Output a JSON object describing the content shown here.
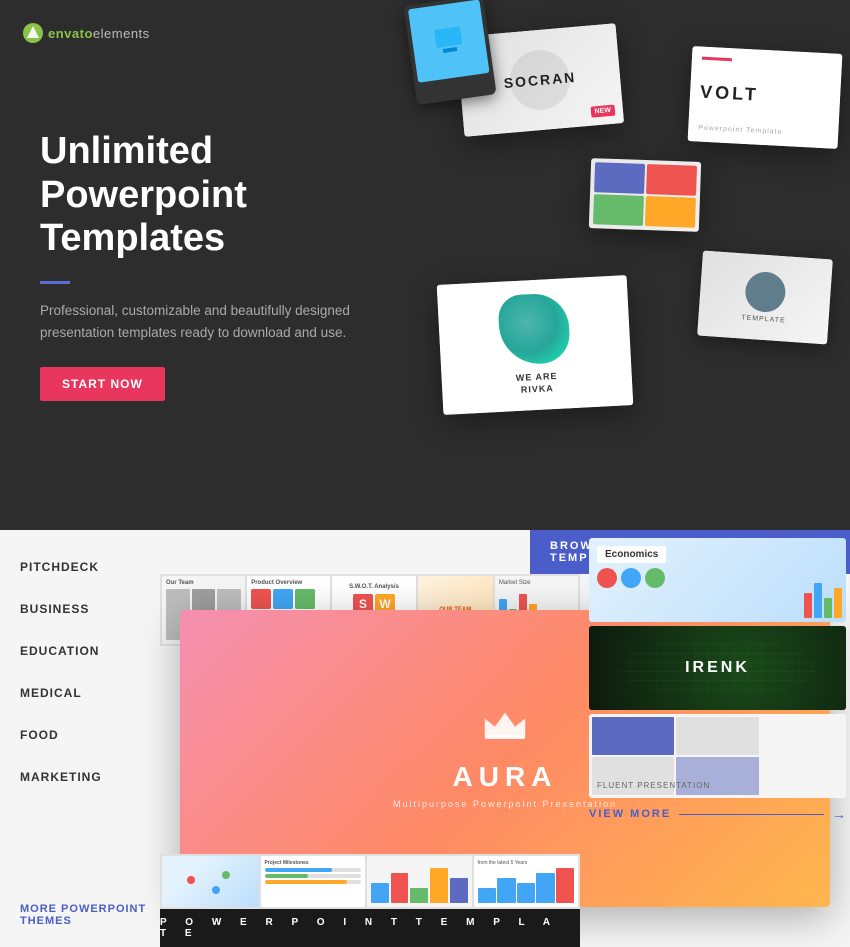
{
  "logo": {
    "brand": "envato",
    "product": "elements"
  },
  "hero": {
    "title": "Unlimited Powerpoint Templates",
    "description": "Professional, customizable and beautifully designed presentation templates ready to download and use.",
    "cta_label": "START NOW",
    "cards": [
      {
        "name": "SOCRAN",
        "badge": "NEW"
      },
      {
        "name": "VOLT",
        "sub": "Powerpoint Template"
      },
      {
        "name": "WE ARE RIVKA"
      }
    ]
  },
  "browse": {
    "header_label": "BROWSE OUR POWERPOINT TEMPLATES",
    "arrow": "→"
  },
  "sidebar": {
    "items": [
      {
        "label": "PITCHDECK",
        "active": false
      },
      {
        "label": "BUSINESS",
        "active": false
      },
      {
        "label": "EDUCATION",
        "active": false
      },
      {
        "label": "MEDICAL",
        "active": false
      },
      {
        "label": "FOOD",
        "active": false
      },
      {
        "label": "MARKETING",
        "active": false
      }
    ],
    "more_label": "MORE POWERPOINT THEMES"
  },
  "main_template": {
    "name": "AURA",
    "subtitle": "Multipurpose Powerpoint Presentation"
  },
  "bottom_bar": {
    "text": "P O W E R P O I N T   T E M P L A T E"
  },
  "right_thumbnails": [
    {
      "name": "Economics",
      "type": "economics"
    },
    {
      "name": "IRENK",
      "type": "irenk"
    },
    {
      "name": "FLUENT PRESENTATION",
      "type": "fluent"
    }
  ],
  "view_more": {
    "label": "VIEW MORE",
    "arrow": "→"
  },
  "colors": {
    "accent_blue": "#4a5dc8",
    "accent_red": "#e8365d",
    "hero_bg": "#2d2d2d",
    "browse_bg": "#f5f5f5"
  }
}
